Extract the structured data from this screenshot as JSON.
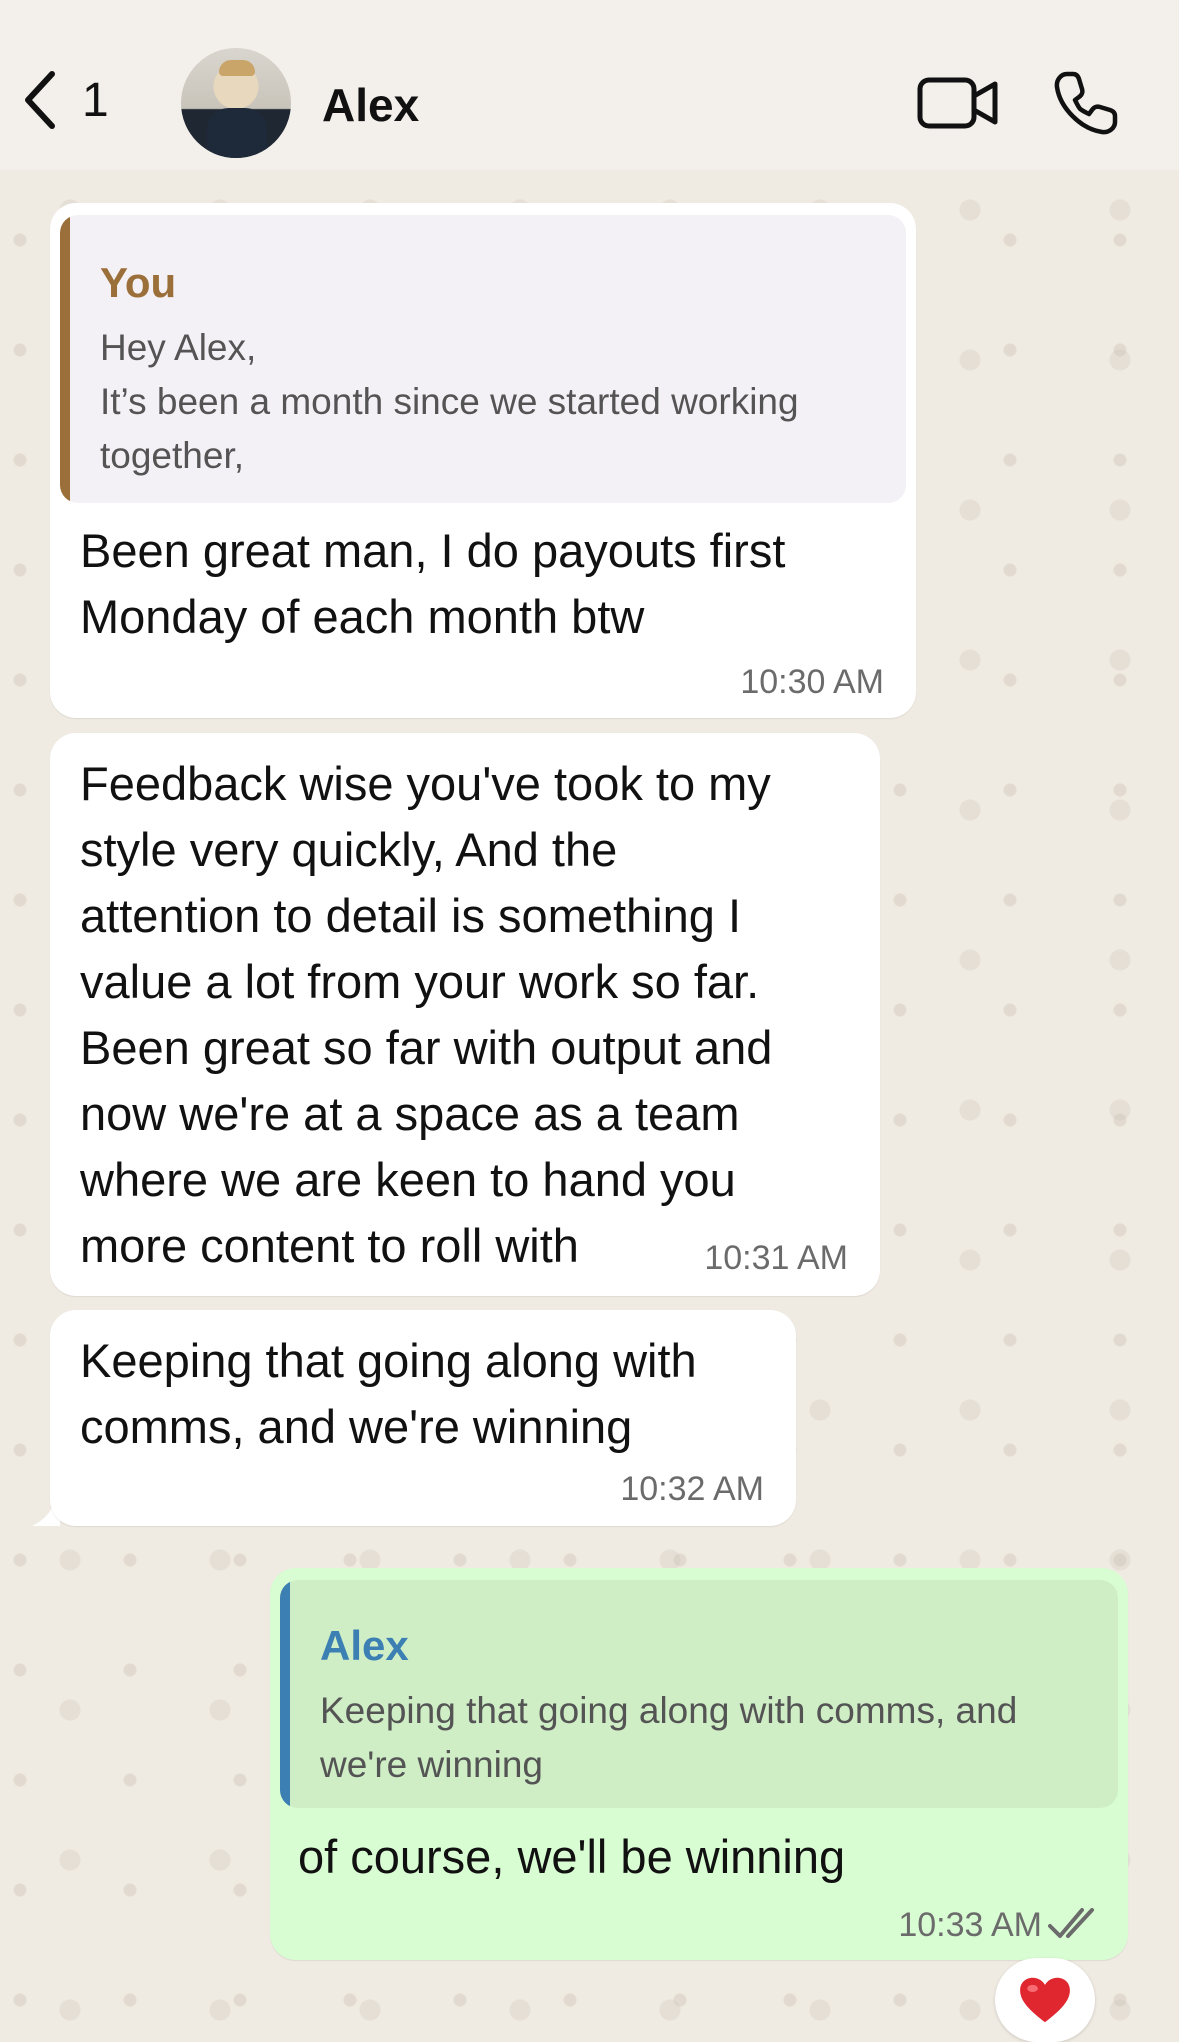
{
  "header": {
    "unread_count": "1",
    "contact_name": "Alex"
  },
  "messages": [
    {
      "direction": "incoming",
      "quote": {
        "author": "You",
        "text": "Hey Alex,\nIt’s been a month since we started working\ntogether,"
      },
      "text": "Been great man, I do payouts first\nMonday of each month btw",
      "time": "10:30 AM"
    },
    {
      "direction": "incoming",
      "text": "Feedback wise you've took to my\nstyle very quickly, And the\nattention to detail is something I\nvalue a lot from your work so far.\nBeen great so far with output and\nnow we're at a space as a team\nwhere we are keen to hand you\nmore content to roll with",
      "time": "10:31 AM"
    },
    {
      "direction": "incoming",
      "text": "Keeping that going along with\ncomms, and we're winning",
      "time": "10:32 AM"
    },
    {
      "direction": "outgoing",
      "quote": {
        "author": "Alex",
        "text": "Keeping that going along with comms, and\nwe're winning"
      },
      "text": "of course, we'll be winning",
      "time": "10:33 AM",
      "status": "read",
      "reaction": "❤️"
    }
  ],
  "colors": {
    "quote_you": "#9b6f3a",
    "quote_alex": "#3b7fb3",
    "outgoing_bubble": "#d9fdd3",
    "incoming_bubble": "#ffffff",
    "read_ticks": "#6b6b6b"
  },
  "icons": [
    "back-chevron-icon",
    "video-call-icon",
    "phone-icon",
    "double-check-icon",
    "heart-icon"
  ]
}
